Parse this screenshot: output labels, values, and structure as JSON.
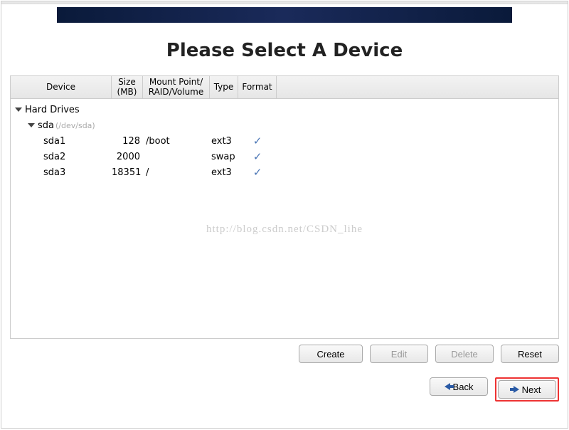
{
  "title": "Please Select A Device",
  "columns": {
    "device": "Device",
    "size": "Size (MB)",
    "mount": "Mount Point/ RAID/Volume",
    "type": "Type",
    "format": "Format"
  },
  "tree": {
    "group": "Hard Drives",
    "disk": {
      "name": "sda",
      "path": "(/dev/sda)"
    },
    "partitions": [
      {
        "name": "sda1",
        "size": "128",
        "mount": "/boot",
        "type": "ext3",
        "format": true
      },
      {
        "name": "sda2",
        "size": "2000",
        "mount": "",
        "type": "swap",
        "format": true
      },
      {
        "name": "sda3",
        "size": "18351",
        "mount": "/",
        "type": "ext3",
        "format": true
      }
    ]
  },
  "buttons": {
    "create": "Create",
    "edit": "Edit",
    "delete": "Delete",
    "reset": "Reset",
    "back": "Back",
    "next": "Next"
  },
  "watermark": "http://blog.csdn.net/CSDN_lihe"
}
